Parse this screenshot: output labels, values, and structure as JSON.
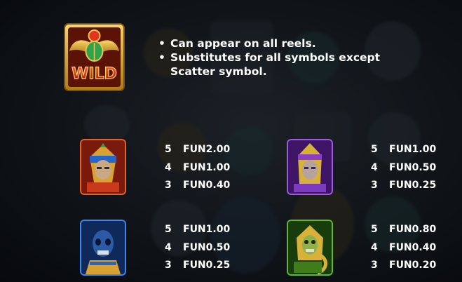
{
  "wild": {
    "symbol_text": "WILD",
    "rules": [
      "Can appear on all reels.",
      "Substitutes for all symbols except Scatter symbol."
    ]
  },
  "paytable": [
    {
      "symbol": "pharaoh-red",
      "pays": [
        {
          "count": "5",
          "amount": "FUN2.00"
        },
        {
          "count": "4",
          "amount": "FUN1.00"
        },
        {
          "count": "3",
          "amount": "FUN0.40"
        }
      ]
    },
    {
      "symbol": "pharaoh-purple",
      "pays": [
        {
          "count": "5",
          "amount": "FUN1.00"
        },
        {
          "count": "4",
          "amount": "FUN0.50"
        },
        {
          "count": "3",
          "amount": "FUN0.25"
        }
      ]
    },
    {
      "symbol": "mummy-blue",
      "pays": [
        {
          "count": "5",
          "amount": "FUN1.00"
        },
        {
          "count": "4",
          "amount": "FUN0.50"
        },
        {
          "count": "3",
          "amount": "FUN0.25"
        }
      ]
    },
    {
      "symbol": "cobra-green",
      "pays": [
        {
          "count": "5",
          "amount": "FUN0.80"
        },
        {
          "count": "4",
          "amount": "FUN0.40"
        },
        {
          "count": "3",
          "amount": "FUN0.20"
        }
      ]
    }
  ],
  "colors": {
    "wild_gold": "#e8b53a",
    "wild_red": "#d32a1e",
    "red_frame": "#c9451d",
    "purple_frame": "#8a3fc6",
    "blue_frame": "#2b6fd6",
    "green_frame": "#4c9a1c"
  }
}
